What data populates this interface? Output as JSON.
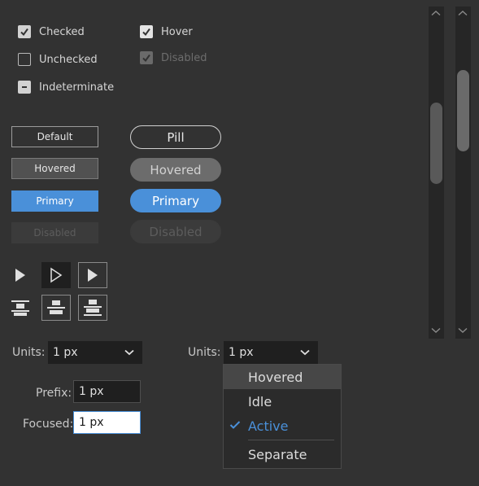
{
  "checkboxes": {
    "checked": "Checked",
    "unchecked": "Unchecked",
    "indeterminate": "Indeterminate",
    "hover": "Hover",
    "disabled": "Disabled"
  },
  "buttons": {
    "default": "Default",
    "hovered": "Hovered",
    "primary": "Primary",
    "disabled": "Disabled"
  },
  "pills": {
    "pill": "Pill",
    "hovered": "Hovered",
    "primary": "Primary",
    "disabled": "Disabled"
  },
  "tools": [
    "select-arrow-icon",
    "direct-select-arrow-icon",
    "select-arrow-icon",
    "align-top-icon",
    "align-center-icon",
    "align-bottom-icon"
  ],
  "units_left": {
    "label": "Units:",
    "value": "1 px"
  },
  "units_right": {
    "label": "Units:",
    "value": "1 px"
  },
  "prefix": {
    "label": "Prefix:",
    "value": "1 px"
  },
  "focused": {
    "label": "Focused:",
    "value": "1 px"
  },
  "menu": {
    "items": [
      "Hovered",
      "Idle",
      "Active",
      "Separate"
    ]
  },
  "colors": {
    "background": "#323232",
    "accent": "#4a90d9",
    "field": "#1f1f1f"
  }
}
